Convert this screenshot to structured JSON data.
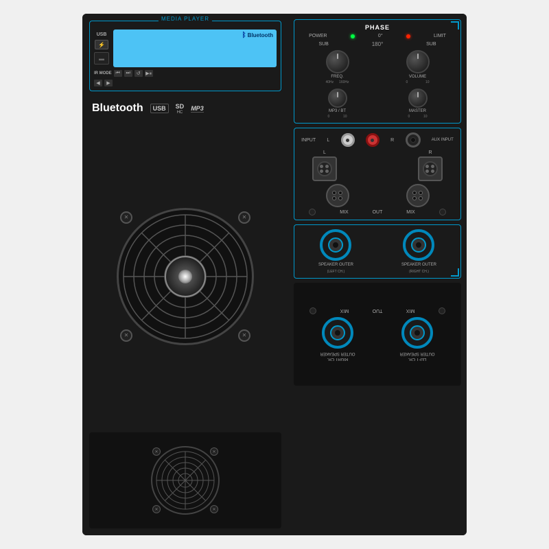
{
  "device": {
    "sections": {
      "media_player": {
        "title": "MEDIA PLAYER",
        "usb_label": "USB",
        "ir_mode_label": "IR MODE",
        "bluetooth_text": "Bluetooth",
        "usb_badge": "USB",
        "sd_badge": "SD",
        "mp3_badge": "MP3"
      },
      "phase": {
        "title": "PHASE",
        "power_label": "POWER",
        "zero_label": "0°",
        "limit_label": "LIMIT",
        "sub_label": "SUB",
        "freq_label": "FREQ.",
        "volume_label": "VOLUME",
        "mp3_bt_label": "MP3 / BT",
        "master_label": "MASTER",
        "hz40_label": "40Hz",
        "hz160_label": "160Hz",
        "deg180_label": "180°"
      },
      "input": {
        "input_label": "INPUT",
        "l_label": "L",
        "r_label": "R",
        "aux_input_label": "AUX INPUT",
        "mix_label": "MIX",
        "out_label": "OUT"
      },
      "speaker": {
        "left_label": "SPEAKER OUTER",
        "left_ch": "(LEFT CH.)",
        "right_label": "SPEAKER OUTER",
        "right_ch": "(RIGHT CH.)"
      }
    }
  }
}
